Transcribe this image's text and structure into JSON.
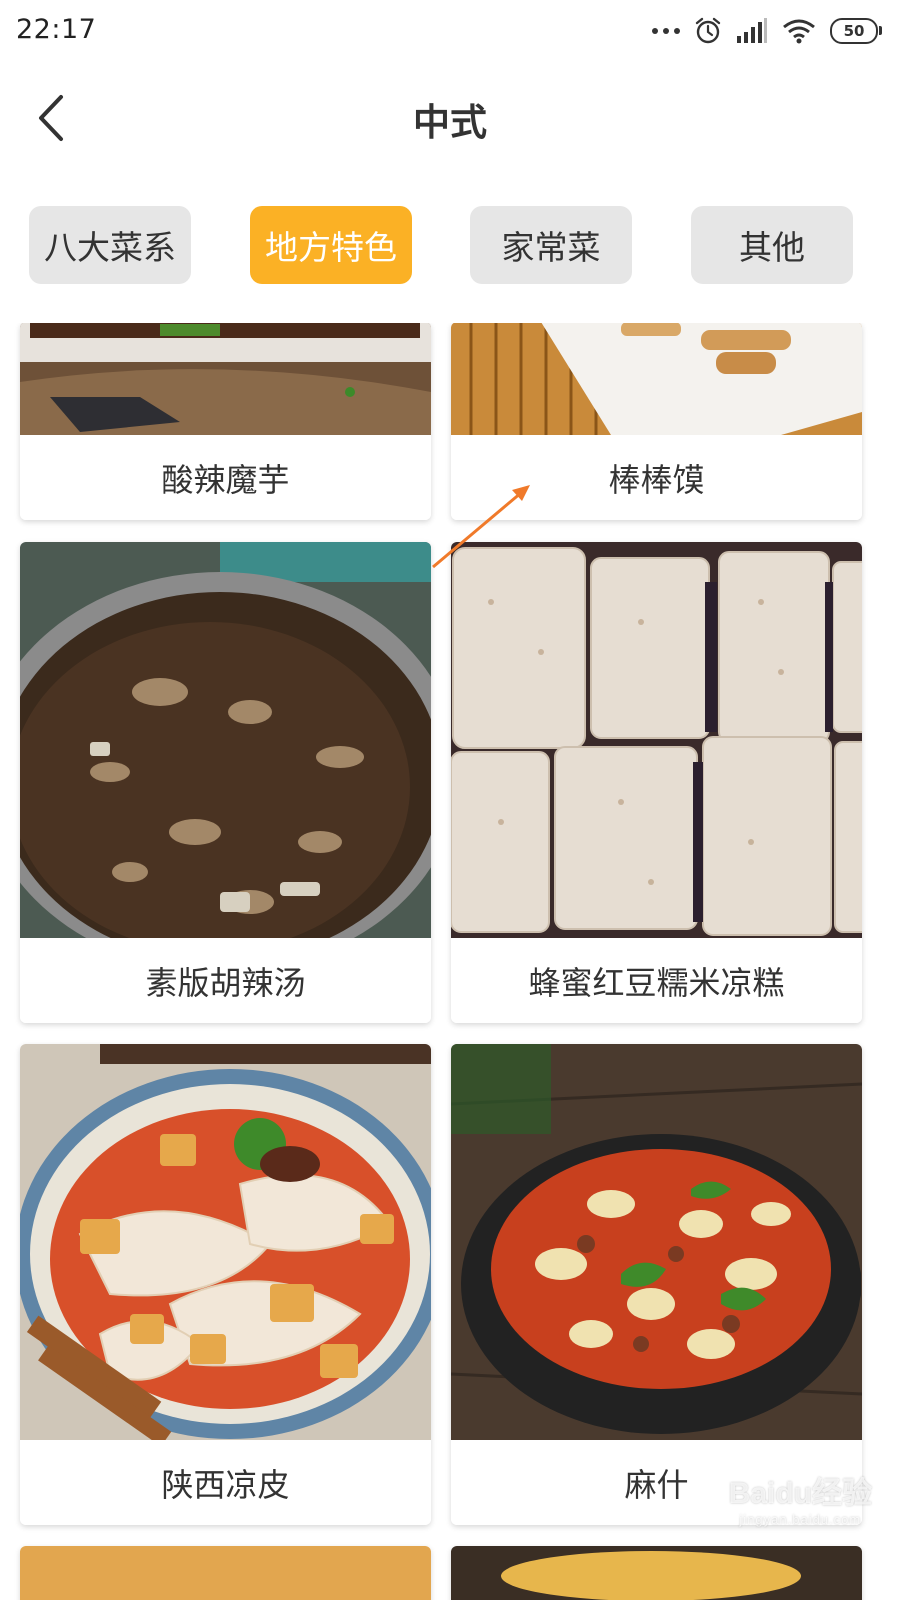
{
  "status_bar": {
    "time": "22:17",
    "battery": "50"
  },
  "header": {
    "title": "中式"
  },
  "tabs": [
    {
      "label": "八大菜系",
      "active": false
    },
    {
      "label": "地方特色",
      "active": true
    },
    {
      "label": "家常菜",
      "active": false
    },
    {
      "label": "其他",
      "active": false
    }
  ],
  "dishes": [
    {
      "name": "酸辣魔芋"
    },
    {
      "name": "棒棒馍"
    },
    {
      "name": "素版胡辣汤"
    },
    {
      "name": "蜂蜜红豆糯米凉糕"
    },
    {
      "name": "陕西凉皮"
    },
    {
      "name": "麻什"
    }
  ],
  "watermark": {
    "brand": "Baidu经验",
    "url": "jingyan.baidu.com"
  },
  "colors": {
    "accent": "#fbb125",
    "tab_inactive": "#e6e6e6",
    "annotation_arrow": "#f07a2a"
  }
}
